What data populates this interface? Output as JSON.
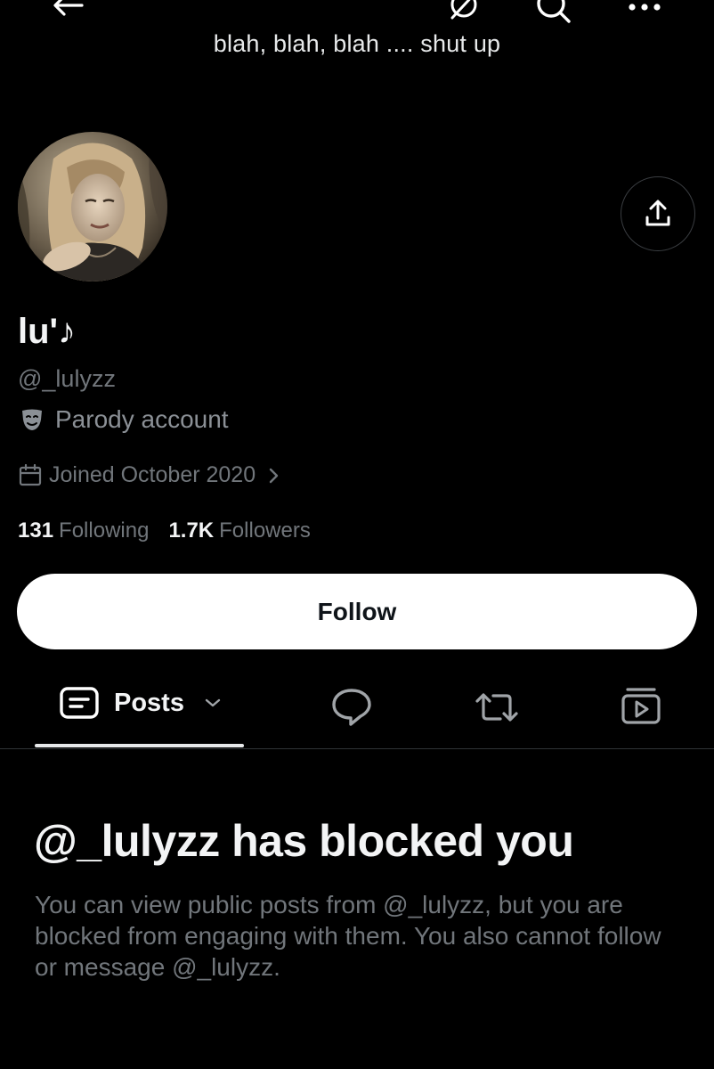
{
  "header": {
    "back_icon": "arrow-left-icon",
    "grok_icon": "grok-icon",
    "search_icon": "search-icon",
    "more_icon": "more-dots-icon",
    "text": "blah, blah, blah .... shut up"
  },
  "profile": {
    "display_name": "lu'♪",
    "handle": "@_lulyzz",
    "parody_label": "Parody account",
    "joined": "Joined October 2020",
    "following_count": "131",
    "following_label": "Following",
    "followers_count": "1.7K",
    "followers_label": "Followers"
  },
  "actions": {
    "share_icon": "share-icon",
    "follow_label": "Follow"
  },
  "tabs": {
    "posts_label": "Posts",
    "replies_icon": "speech-bubble-icon",
    "reposts_icon": "repost-icon",
    "media_icon": "video-stack-icon"
  },
  "blocked": {
    "title": "@_lulyzz has blocked you",
    "description": "You can view public posts from @_lulyzz, but you are blocked from engaging with them. You also cannot follow or message @_lulyzz."
  },
  "colors": {
    "background": "#000000",
    "text_primary": "#f3f4f5",
    "text_secondary": "#71767b",
    "button_bg": "#ffffff"
  }
}
